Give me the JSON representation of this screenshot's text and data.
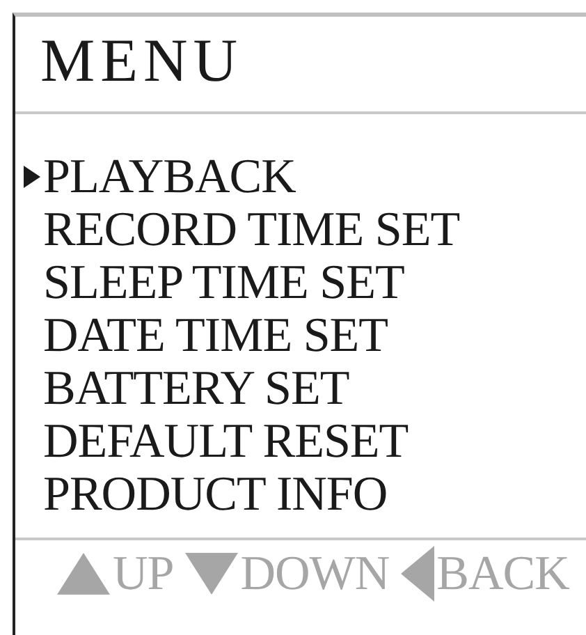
{
  "title": "MENU",
  "items": [
    {
      "label": "PLAYBACK",
      "selected": true
    },
    {
      "label": "RECORD TIME SET",
      "selected": false
    },
    {
      "label": "SLEEP TIME SET",
      "selected": false
    },
    {
      "label": "DATE TIME SET",
      "selected": false
    },
    {
      "label": "BATTERY SET",
      "selected": false
    },
    {
      "label": "DEFAULT RESET",
      "selected": false
    },
    {
      "label": "PRODUCT INFO",
      "selected": false
    }
  ],
  "keys": [
    {
      "kind": "up",
      "label": "UP"
    },
    {
      "kind": "down",
      "label": "DOWN"
    },
    {
      "kind": "back",
      "label": "BACK"
    }
  ]
}
